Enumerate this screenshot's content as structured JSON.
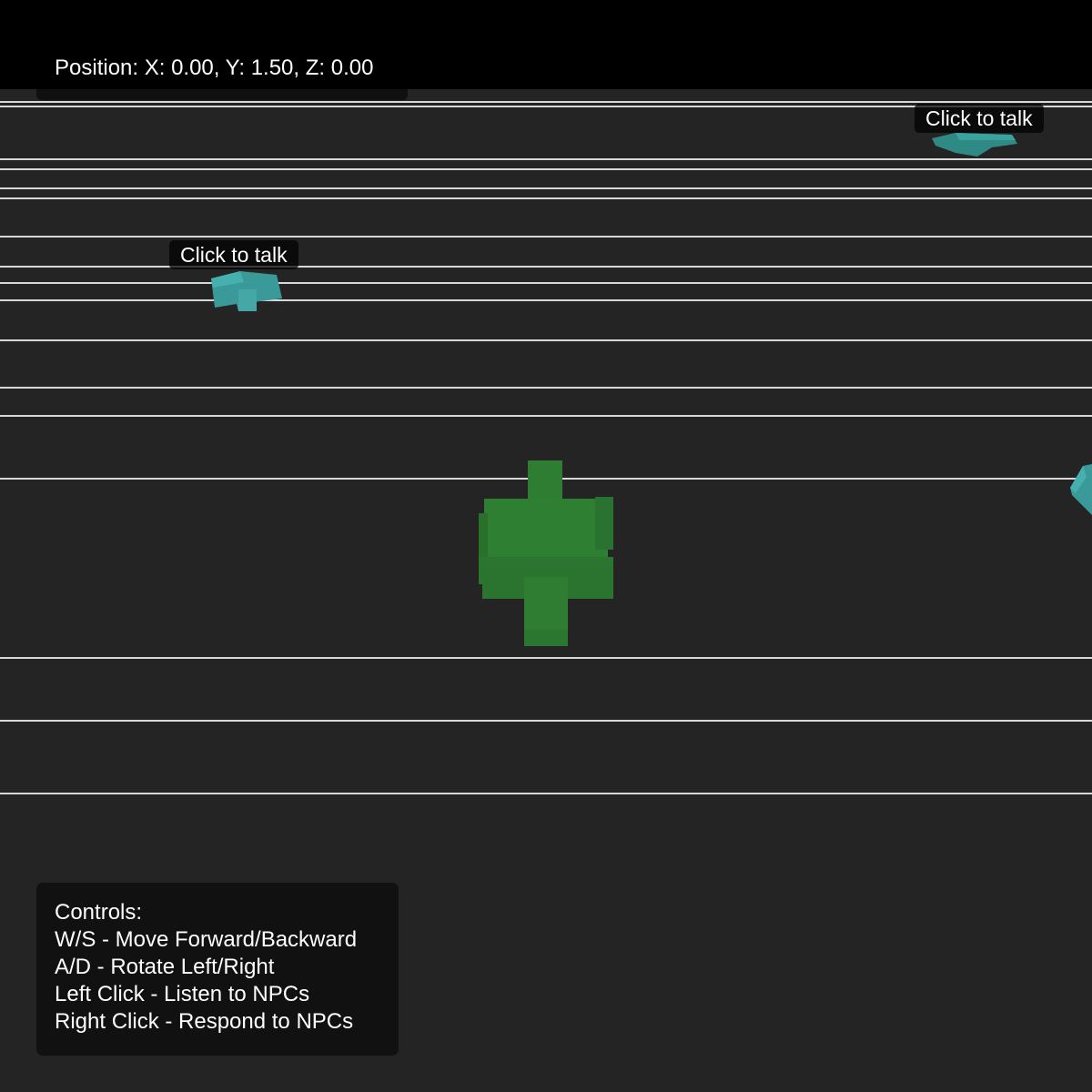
{
  "hud": {
    "position_text": "Position: X: 0.00, Y: 1.50, Z: 0.00"
  },
  "npcs": [
    {
      "label": "Click to talk",
      "color": "#3a9a9a"
    },
    {
      "label": "Click to talk",
      "color": "#3a9a9a"
    }
  ],
  "player": {
    "color": "#2e7d32"
  },
  "controls": {
    "title": "Controls:",
    "lines": [
      "W/S - Move Forward/Backward",
      "A/D - Rotate Left/Right",
      "Left Click - Listen to NPCs",
      "Right Click - Respond to NPCs"
    ]
  },
  "colors": {
    "ground": "#242424",
    "sky": "#000000",
    "grid_line": "#d8d8d8",
    "npc": "#3a9a9a",
    "player": "#2e7d32"
  }
}
